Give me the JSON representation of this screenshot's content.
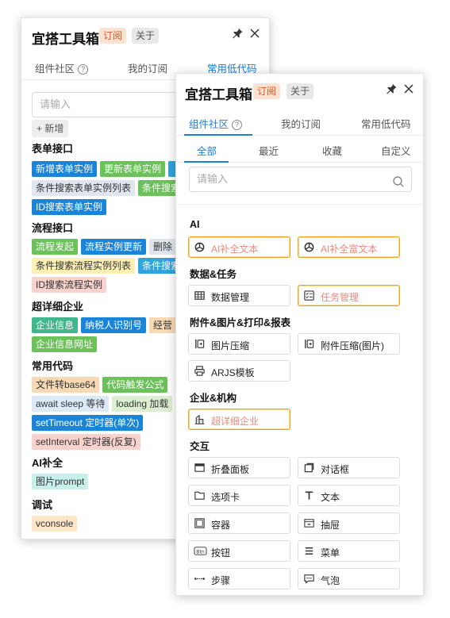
{
  "app": {
    "title": "宜搭工具箱",
    "subscribe_badge": "订阅",
    "about_badge": "关于",
    "pin_icon": "pin-icon",
    "close_icon": "close-icon"
  },
  "tabs": [
    "组件社区",
    "我的订阅",
    "常用低代码"
  ],
  "help_glyph": "?",
  "back_panel": {
    "active_tab": "常用低代码",
    "search_placeholder": "请输入",
    "add_label": "+ 新增",
    "sections": [
      {
        "title": "表单接口",
        "rows": [
          [
            {
              "t": "新增表单实例",
              "c": "blue"
            },
            {
              "t": "更新表单实例",
              "c": "green"
            },
            {
              "t": "",
              "c": "sky"
            }
          ],
          [
            {
              "t": "条件搜索表单实例列表",
              "c": "lgray"
            },
            {
              "t": "条件搜索",
              "c": "green"
            }
          ],
          [
            {
              "t": "ID搜索表单实例",
              "c": "blue"
            }
          ]
        ]
      },
      {
        "title": "流程接口",
        "rows": [
          [
            {
              "t": "流程发起",
              "c": "green"
            },
            {
              "t": "流程实例更新",
              "c": "blue"
            },
            {
              "t": "删除",
              "c": "lgray"
            }
          ],
          [
            {
              "t": "条件搜索流程实例列表",
              "c": "yellow"
            },
            {
              "t": "条件搜索",
              "c": "sky"
            }
          ],
          [
            {
              "t": "ID搜索流程实例",
              "c": "pink"
            }
          ]
        ]
      },
      {
        "title": "超详细企业",
        "rows": [
          [
            {
              "t": "企业信息",
              "c": "teal"
            },
            {
              "t": "纳税人识别号",
              "c": "blue"
            },
            {
              "t": "经营",
              "c": "orange"
            }
          ],
          [
            {
              "t": "企业信息网址",
              "c": "green"
            }
          ]
        ]
      },
      {
        "title": "常用代码",
        "rows": [
          [
            {
              "t": "文件转base64",
              "c": "orange"
            },
            {
              "t": "代码触发公式",
              "c": "green"
            }
          ],
          [
            {
              "t": "await sleep 等待",
              "c": "lblue"
            },
            {
              "t": "loading 加载",
              "c": "lgreen"
            }
          ],
          [
            {
              "t": "setTimeout 定时器(单次)",
              "c": "blue"
            }
          ],
          [
            {
              "t": "setInterval 定时器(反复)",
              "c": "pink"
            }
          ]
        ]
      },
      {
        "title": "AI补全",
        "rows": [
          [
            {
              "t": "图片prompt",
              "c": "mint"
            }
          ]
        ]
      },
      {
        "title": "调试",
        "rows": [
          [
            {
              "t": "vconsole",
              "c": "cream"
            }
          ]
        ]
      }
    ]
  },
  "front_panel": {
    "active_tab": "组件社区",
    "subtabs": [
      "全部",
      "最近",
      "收藏",
      "自定义"
    ],
    "active_subtab": "全部",
    "search_placeholder": "请输入",
    "search_icon": "search-icon",
    "sections": [
      {
        "title": "AI",
        "items": [
          {
            "label": "AI补全文本",
            "icon": "openai-icon",
            "highlight": true
          },
          {
            "label": "AI补全富文本",
            "icon": "openai-icon",
            "highlight": true
          }
        ]
      },
      {
        "title": "数据&任务",
        "items": [
          {
            "label": "数据管理",
            "icon": "table-icon",
            "highlight": false
          },
          {
            "label": "任务管理",
            "icon": "checklist-icon",
            "highlight": true
          }
        ]
      },
      {
        "title": "附件&图片&打印&报表",
        "items": [
          {
            "label": "图片压缩",
            "icon": "compress-icon",
            "highlight": false
          },
          {
            "label": "附件压缩(图片)",
            "icon": "compress-icon",
            "highlight": false
          },
          {
            "label": "ARJS模板",
            "icon": "printer-icon",
            "highlight": false
          }
        ]
      },
      {
        "title": "企业&机构",
        "items": [
          {
            "label": "超详细企业",
            "icon": "building-icon",
            "highlight": true
          }
        ]
      },
      {
        "title": "交互",
        "items": [
          {
            "label": "折叠面板",
            "icon": "collapse-panel-icon",
            "highlight": false
          },
          {
            "label": "对话框",
            "icon": "dialog-icon",
            "highlight": false
          },
          {
            "label": "选项卡",
            "icon": "folder-tab-icon",
            "highlight": false
          },
          {
            "label": "文本",
            "icon": "text-icon",
            "highlight": false
          },
          {
            "label": "容器",
            "icon": "container-icon",
            "highlight": false
          },
          {
            "label": "抽屉",
            "icon": "drawer-icon",
            "highlight": false
          },
          {
            "label": "按钮",
            "icon": "button-icon",
            "highlight": false
          },
          {
            "label": "菜单",
            "icon": "menu-icon",
            "highlight": false
          },
          {
            "label": "步骤",
            "icon": "steps-icon",
            "highlight": false
          },
          {
            "label": "气泡",
            "icon": "bubble-icon",
            "highlight": false
          }
        ]
      }
    ]
  }
}
